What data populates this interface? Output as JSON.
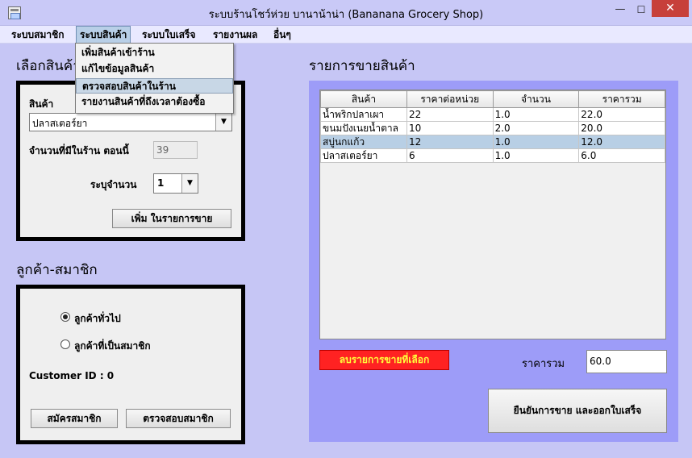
{
  "window": {
    "title": "ระบบร้านโชว์ห่วย บานาน้าน่า (Bananana Grocery Shop)",
    "controls": [
      "—",
      "☐",
      "✕"
    ]
  },
  "menubar": {
    "items": [
      "ระบบสมาชิก",
      "ระบบสินค้า",
      "ระบบใบเสร็จ",
      "รายงานผล",
      "อื่นๆ"
    ],
    "open_menu": "ระบบสินค้า"
  },
  "dropdown": {
    "items": [
      "เพิ่มสินค้าเข้าร้าน",
      "แก้ไขข้อมูลสินค้า",
      "ตรวจสอบสินค้าในร้าน",
      "รายงานสินค้าที่ถึงเวลาต้องซื้อ"
    ],
    "highlighted": "ตรวจสอบสินค้าในร้าน"
  },
  "product_section": {
    "title": "เลือกสินค้า",
    "product_label": "สินค้า",
    "product_selected": "ปลาสเตอร์ยา",
    "stock_label": "จำนวนที่มีในร้าน ตอนนี้",
    "stock_value": "39",
    "qty_label": "ระบุจำนวน",
    "qty_value": "1",
    "add_button": "เพิ่ม ในรายการขาย"
  },
  "customer_section": {
    "title": "ลูกค้า-สมาชิก",
    "option_general": "ลูกค้าทั่วไป",
    "option_member": "ลูกค้าที่เป็นสมาชิก",
    "selected_option": "ลูกค้าทั่วไป",
    "customer_id": "Customer ID : 0",
    "register_button": "สมัครสมาชิก",
    "check_member_button": "ตรวจสอบสมาชิก"
  },
  "sales_section": {
    "title": "รายการขายสินค้า",
    "columns": [
      "สินค้า",
      "ราคาต่อหน่วย",
      "จำนวน",
      "ราคารวม"
    ],
    "rows": [
      [
        "น้ำพริกปลาเผา",
        "22",
        "1.0",
        "22.0"
      ],
      [
        "ขนมปังเนยน้ำตาล",
        "10",
        "2.0",
        "20.0"
      ],
      [
        "สบู่นกแก้ว",
        "12",
        "1.0",
        "12.0"
      ],
      [
        "ปลาสเตอร์ยา",
        "6",
        "1.0",
        "6.0"
      ]
    ],
    "selected_row": 2,
    "remove_button": "ลบรายการขายที่เลือก",
    "total_label": "ราคารวม",
    "total_value": "60.0",
    "confirm_button": "ยืนยันการขาย และออกใบเสร็จ"
  }
}
